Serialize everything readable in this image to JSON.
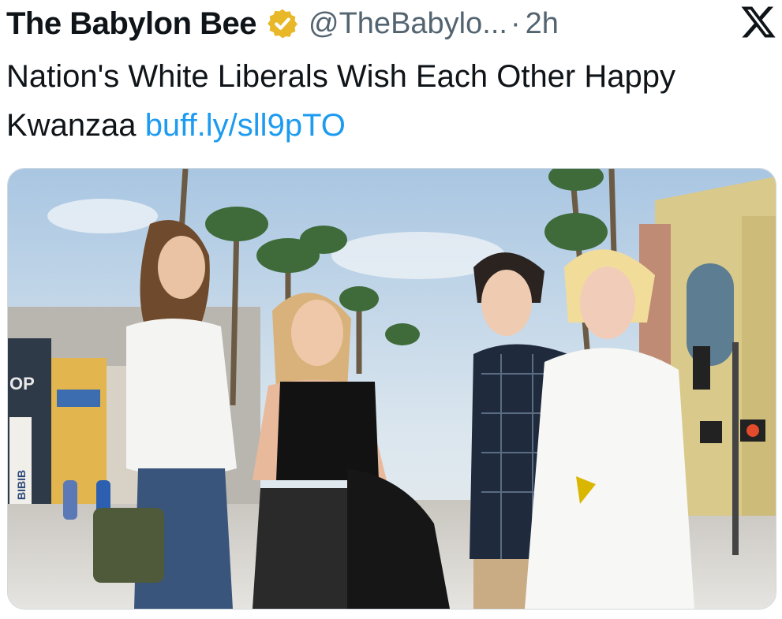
{
  "tweet": {
    "author_name": "The Babylon Bee",
    "verified_badge_icon": "verified-gold-badge-icon",
    "handle": "@TheBabylo...",
    "separator": "·",
    "time": "2h",
    "text": "Nation's White Liberals Wish Each Other Happy Kwanzaa",
    "link_text": "buff.ly/sll9pTO"
  },
  "header": {
    "logo_icon": "x-logo-icon"
  },
  "media": {
    "alt": "Four young people chatting on a sunny palm-lined pedestrian street",
    "storefront_sign": "OP",
    "vertical_sign": "BIBIB",
    "kind": "photo"
  },
  "colors": {
    "link": "#1d9bf0",
    "badge": "#e8b829",
    "muted": "#536471",
    "text": "#0f1419"
  }
}
